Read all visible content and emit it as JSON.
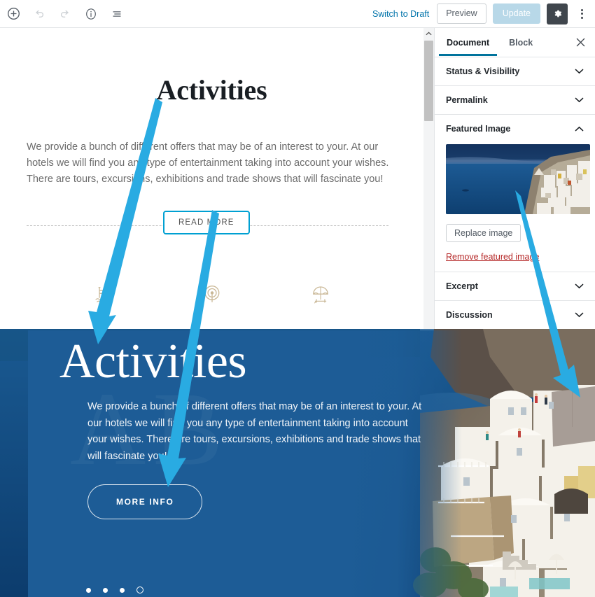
{
  "toolbar": {
    "add_label": "Add block",
    "undo_label": "Undo",
    "redo_label": "Redo",
    "info_label": "Content structure",
    "outline_label": "Block navigation",
    "switch_to_draft": "Switch to Draft",
    "preview": "Preview",
    "update": "Update",
    "settings_label": "Settings",
    "more_label": "More tools & options",
    "accent": "#0073aa",
    "gear_bg": "#40464d",
    "update_bg": "#b8d8e8"
  },
  "editor": {
    "title": "Activities",
    "paragraph": "We provide a bunch of different offers that may be of an interest to your. At our hotels we will find you any type of entertainment taking into account your wishes. There are tours, excursions, exhibitions and trade shows that will fascinate you!",
    "read_more": "READ MORE",
    "selected_block_color": "#00a0d2",
    "icons": [
      "pool-ladder-icon",
      "wifi-signal-icon",
      "beach-umbrella-icon"
    ],
    "icon_color": "#c9b795"
  },
  "sidebar": {
    "tabs": [
      {
        "label": "Document",
        "active": true
      },
      {
        "label": "Block",
        "active": false
      }
    ],
    "close_label": "Close settings",
    "panels": [
      {
        "label": "Status & Visibility",
        "expanded": false
      },
      {
        "label": "Permalink",
        "expanded": false
      },
      {
        "label": "Featured Image",
        "expanded": true
      },
      {
        "label": "Excerpt",
        "expanded": false
      },
      {
        "label": "Discussion",
        "expanded": false
      }
    ],
    "featured_image": {
      "alt": "santorini-coastline-thumbnail",
      "replace_label": "Replace image",
      "remove_label": "Remove featured image",
      "remove_color": "#b52727"
    },
    "active_tab_underline": "#00739c"
  },
  "frontend": {
    "title": "Activities",
    "paragraph": "We provide a bunch of different offers that may be of an interest to your. At our hotels we will find you any type of entertainment taking into account your wishes. There are tours, excursions, exhibitions and trade shows that will fascinate you!",
    "button": "MORE INFO",
    "overlay_color": "#1d5c96",
    "background_alt": "santorini-cliffside-village-photo",
    "carousel_dots": [
      {
        "state": "inactive"
      },
      {
        "state": "inactive"
      },
      {
        "state": "inactive"
      },
      {
        "state": "active"
      }
    ]
  },
  "annotations": {
    "arrow_color": "#29abe2",
    "arrows": [
      {
        "name": "title-mapping-arrow",
        "from": "editor-title",
        "to": "frontend-title"
      },
      {
        "name": "button-mapping-arrow",
        "from": "editor-read-more",
        "to": "frontend-more-info"
      },
      {
        "name": "featured-image-mapping-arrow",
        "from": "sidebar-featured-image",
        "to": "frontend-background"
      }
    ]
  }
}
